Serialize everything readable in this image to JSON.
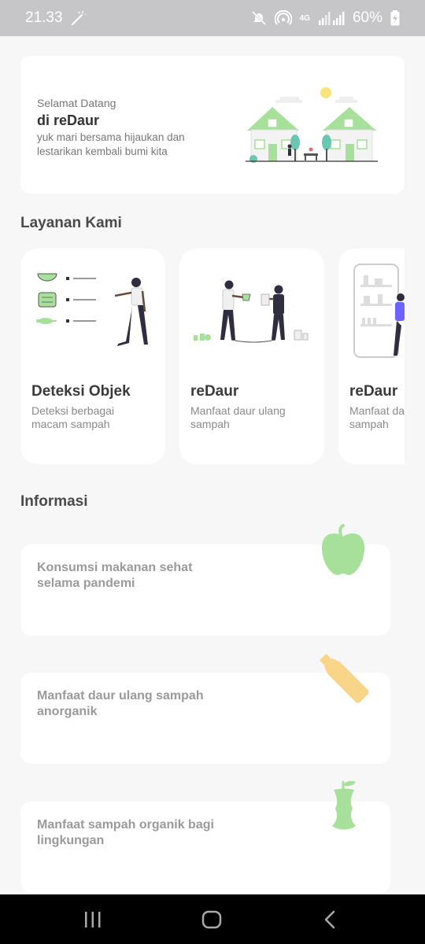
{
  "status_bar": {
    "time": "21.33",
    "network": "4G",
    "battery": "60%",
    "icons": [
      "magic-wand-icon",
      "mute-icon",
      "hotspot-icon",
      "signal-icon",
      "battery-icon"
    ]
  },
  "welcome": {
    "greeting": "Selamat Datang",
    "brand": "di reDaur",
    "tagline": "yuk mari bersama hijaukan dan lestarikan kembali bumi kita"
  },
  "services": {
    "section_title": "Layanan Kami",
    "items": [
      {
        "title": "Deteksi Objek",
        "description": "Deteksi berbagai macam sampah"
      },
      {
        "title": "reDaur",
        "description": "Manfaat daur ulang sampah"
      },
      {
        "title": "reDaur",
        "description": "Manfaat daur ulang sampah"
      }
    ]
  },
  "information": {
    "section_title": "Informasi",
    "items": [
      {
        "title": "Konsumsi makanan sehat selama pandemi",
        "icon": "apple-icon"
      },
      {
        "title": "Manfaat daur ulang sampah anorganik",
        "icon": "bottle-icon"
      },
      {
        "title": "Manfaat sampah organik bagi lingkungan",
        "icon": "apple-core-icon"
      }
    ]
  },
  "colors": {
    "accent_green": "#a6e09a",
    "bottle_yellow": "#f9d58a",
    "dark_figure": "#2f2e41",
    "status_bar_bg": "#c6c6c8"
  },
  "nav_bar": {
    "buttons": [
      "recent-apps-icon",
      "home-icon",
      "back-icon"
    ]
  }
}
